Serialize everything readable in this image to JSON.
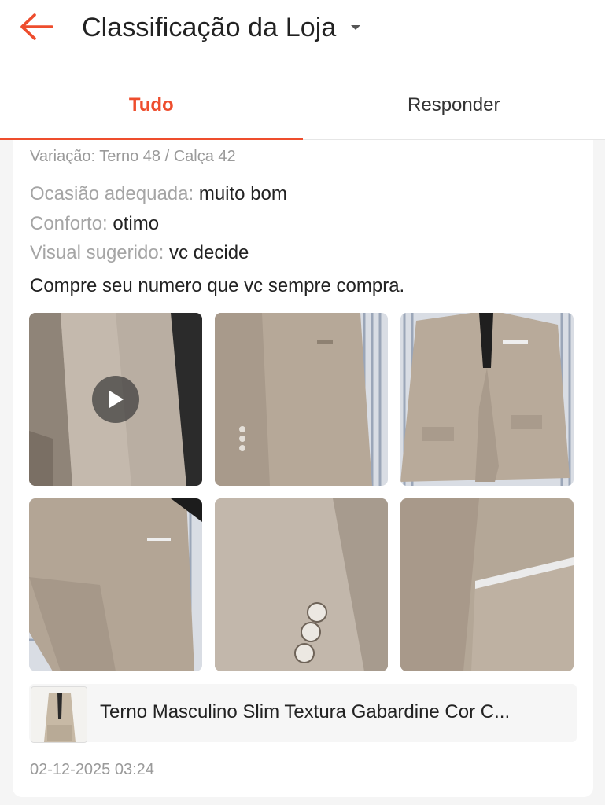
{
  "header": {
    "title": "Classificação da Loja",
    "back_icon": "arrow-left-icon",
    "dropdown_icon": "caret-down-icon",
    "accent_color": "#ee4d2d"
  },
  "tabs": [
    {
      "label": "Tudo",
      "active": true
    },
    {
      "label": "Responder",
      "active": false
    }
  ],
  "review": {
    "variation": "Variação: Terno 48 / Calça 42",
    "attributes": [
      {
        "key": "Ocasião adequada:",
        "value": "muito bom"
      },
      {
        "key": "Conforto:",
        "value": "otimo"
      },
      {
        "key": "Visual sugerido:",
        "value": "vc decide"
      }
    ],
    "comment": "Compre seu numero que vc sempre compra.",
    "media": [
      {
        "type": "video",
        "icon": "play-icon"
      },
      {
        "type": "image"
      },
      {
        "type": "image"
      },
      {
        "type": "image"
      },
      {
        "type": "image"
      },
      {
        "type": "image"
      }
    ],
    "product": {
      "name": "Terno Masculino Slim Textura Gabardine Cor C..."
    },
    "timestamp": "02-12-2025 03:24"
  }
}
